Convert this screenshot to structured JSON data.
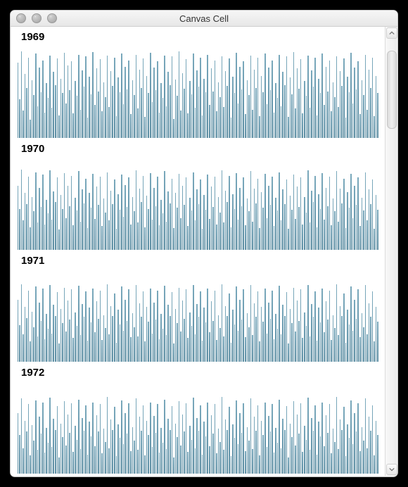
{
  "window": {
    "title": "Canvas Cell",
    "traffic_lights": [
      "close",
      "minimize",
      "zoom"
    ]
  },
  "scrollbar": {
    "thumb_top_pct": 3,
    "thumb_height_pct": 18
  },
  "chart_data": [
    {
      "type": "bar",
      "title": "1969",
      "xlabel": "",
      "ylabel": "",
      "ylim": [
        0,
        100
      ],
      "categories_note": "daily (≈200 bars shown)",
      "values": [
        82,
        42,
        95,
        30,
        70,
        55,
        88,
        20,
        63,
        47,
        92,
        35,
        77,
        50,
        85,
        28,
        60,
        44,
        90,
        33,
        72,
        58,
        87,
        25,
        65,
        49,
        93,
        38,
        79,
        52,
        84,
        27,
        62,
        46,
        91,
        31,
        74,
        56,
        89,
        22,
        67,
        48,
        94,
        36,
        76,
        51,
        86,
        29,
        61,
        45,
        90,
        34,
        73,
        57,
        88,
        24,
        66,
        50,
        92,
        37,
        78,
        53,
        85,
        26,
        63,
        47,
        91,
        32,
        75,
        55,
        87,
        23,
        68,
        49,
        93,
        39,
        77,
        52,
        84,
        28,
        60,
        44,
        90,
        35,
        72,
        58,
        89,
        21,
        64,
        46,
        95,
        30,
        71,
        54,
        86,
        27,
        62,
        48,
        92,
        33,
        74,
        56,
        88,
        25,
        65,
        50,
        91,
        36,
        76,
        51,
        85,
        29,
        61,
        45,
        89,
        34,
        73,
        57,
        87,
        22,
        67,
        49,
        93,
        38,
        78,
        53,
        84,
        26,
        63,
        47,
        90,
        31,
        75,
        55,
        88,
        24,
        68,
        50,
        92,
        37,
        77,
        52,
        85,
        28,
        60,
        44,
        91,
        35,
        72,
        58,
        89,
        23,
        66,
        48,
        94,
        32,
        76,
        54,
        86,
        27,
        62,
        46,
        90,
        33,
        74,
        56,
        88,
        25,
        65,
        49,
        92,
        36,
        78,
        51,
        85,
        29,
        61,
        45,
        89,
        34,
        73,
        57,
        87,
        22,
        67,
        50,
        93,
        38,
        77,
        53,
        84,
        26,
        63,
        47,
        91,
        31,
        75,
        55,
        88,
        24,
        68,
        49
      ]
    },
    {
      "type": "bar",
      "title": "1970",
      "xlabel": "",
      "ylabel": "",
      "ylim": [
        0,
        100
      ],
      "values": [
        70,
        45,
        88,
        32,
        62,
        50,
        80,
        25,
        58,
        42,
        85,
        30,
        68,
        47,
        82,
        28,
        55,
        40,
        87,
        33,
        64,
        52,
        79,
        22,
        60,
        45,
        84,
        35,
        70,
        48,
        81,
        27,
        57,
        43,
        86,
        31,
        66,
        51,
        78,
        24,
        62,
        46,
        83,
        34,
        69,
        49,
        80,
        26,
        56,
        41,
        85,
        32,
        65,
        50,
        77,
        23,
        61,
        44,
        82,
        36,
        71,
        47,
        79,
        28,
        58,
        42,
        87,
        30,
        67,
        52,
        81,
        25,
        59,
        45,
        84,
        33,
        68,
        48,
        80,
        27,
        55,
        40,
        86,
        31,
        64,
        51,
        78,
        24,
        62,
        46,
        83,
        35,
        70,
        49,
        79,
        26,
        57,
        43,
        85,
        32,
        66,
        50,
        77,
        23,
        60,
        44,
        82,
        34,
        69,
        47,
        80,
        28,
        58,
        41,
        87,
        30,
        65,
        52,
        81,
        25,
        61,
        45,
        84,
        33,
        68,
        48,
        79,
        27,
        56,
        42,
        86,
        31,
        67,
        51,
        78,
        24,
        63,
        46,
        83,
        35,
        70,
        49,
        80,
        26,
        57,
        43,
        85,
        32,
        66,
        50,
        77,
        23,
        59,
        44,
        82,
        34,
        69,
        47,
        79,
        28,
        58,
        41,
        87,
        30,
        65,
        52,
        81,
        25,
        61,
        45,
        84,
        33,
        68,
        48,
        80,
        27,
        56,
        42,
        86,
        31,
        67,
        51,
        78,
        24,
        63,
        46,
        83,
        35,
        70,
        49,
        79,
        26,
        57,
        43,
        85,
        32,
        66,
        50,
        77,
        23,
        60,
        44
      ]
    },
    {
      "type": "bar",
      "title": "1971",
      "xlabel": "",
      "ylabel": "",
      "ylim": [
        0,
        100
      ],
      "values": [
        68,
        40,
        85,
        30,
        60,
        48,
        78,
        22,
        55,
        38,
        82,
        28,
        65,
        45,
        80,
        25,
        52,
        36,
        84,
        31,
        62,
        50,
        76,
        20,
        58,
        42,
        81,
        33,
        67,
        46,
        79,
        26,
        54,
        39,
        83,
        29,
        63,
        49,
        77,
        23,
        59,
        43,
        80,
        32,
        66,
        47,
        78,
        24,
        51,
        37,
        85,
        30,
        61,
        50,
        75,
        21,
        57,
        41,
        82,
        34,
        68,
        45,
        79,
        27,
        53,
        38,
        84,
        28,
        64,
        49,
        77,
        22,
        60,
        44,
        80,
        31,
        65,
        46,
        78,
        25,
        52,
        36,
        83,
        29,
        62,
        50,
        76,
        20,
        58,
        42,
        81,
        33,
        67,
        47,
        79,
        26,
        54,
        39,
        84,
        30,
        63,
        49,
        77,
        23,
        59,
        43,
        80,
        32,
        66,
        45,
        78,
        24,
        51,
        37,
        85,
        28,
        61,
        50,
        75,
        21,
        57,
        41,
        82,
        34,
        68,
        46,
        79,
        27,
        53,
        38,
        84,
        29,
        64,
        49,
        77,
        22,
        60,
        44,
        80,
        31,
        65,
        47,
        78,
        25,
        52,
        36,
        83,
        30,
        62,
        50,
        76,
        20,
        58,
        42,
        81,
        33,
        67,
        45,
        79,
        26,
        54,
        39,
        84,
        28,
        63,
        49,
        77,
        23,
        59,
        43,
        80,
        32,
        66,
        46,
        78,
        24,
        51,
        37,
        85,
        29,
        61,
        50,
        75,
        21,
        57,
        41,
        82,
        34,
        68,
        47,
        79,
        27,
        53,
        38,
        84,
        30,
        64,
        49,
        77,
        22,
        60,
        44
      ]
    },
    {
      "type": "bar",
      "title": "1972",
      "xlabel": "",
      "ylabel": "",
      "ylim": [
        0,
        100
      ],
      "values": [
        66,
        42,
        82,
        28,
        58,
        46,
        76,
        20,
        53,
        36,
        80,
        26,
        62,
        44,
        78,
        23,
        50,
        34,
        83,
        29,
        60,
        48,
        74,
        18,
        55,
        40,
        79,
        31,
        65,
        45,
        77,
        24,
        52,
        37,
        81,
        27,
        61,
        47,
        75,
        21,
        57,
        41,
        78,
        30,
        64,
        46,
        76,
        22,
        49,
        35,
        84,
        28,
        59,
        48,
        73,
        19,
        54,
        39,
        80,
        32,
        66,
        44,
        77,
        25,
        51,
        36,
        82,
        26,
        62,
        47,
        75,
        20,
        58,
        42,
        78,
        29,
        63,
        45,
        76,
        23,
        50,
        34,
        81,
        27,
        60,
        48,
        74,
        18,
        55,
        40,
        79,
        31,
        65,
        46,
        77,
        24,
        52,
        37,
        83,
        28,
        61,
        47,
        75,
        21,
        57,
        41,
        78,
        30,
        64,
        44,
        76,
        22,
        49,
        35,
        84,
        26,
        59,
        48,
        73,
        19,
        54,
        39,
        80,
        32,
        66,
        45,
        77,
        25,
        51,
        36,
        82,
        27,
        62,
        47,
        75,
        20,
        58,
        42,
        78,
        29,
        63,
        46,
        76,
        23,
        50,
        34,
        81,
        28,
        60,
        48,
        74,
        18,
        55,
        40,
        79,
        31,
        65,
        44,
        77,
        24,
        52,
        37,
        83,
        26,
        61,
        47,
        75,
        21,
        57,
        41,
        78,
        30,
        64,
        45,
        76,
        22,
        49,
        35,
        84,
        27,
        59,
        48,
        73,
        19,
        54,
        39,
        80,
        32,
        66,
        46,
        77,
        25,
        51,
        36,
        82,
        28,
        62,
        47,
        75,
        20,
        58,
        42
      ]
    }
  ]
}
